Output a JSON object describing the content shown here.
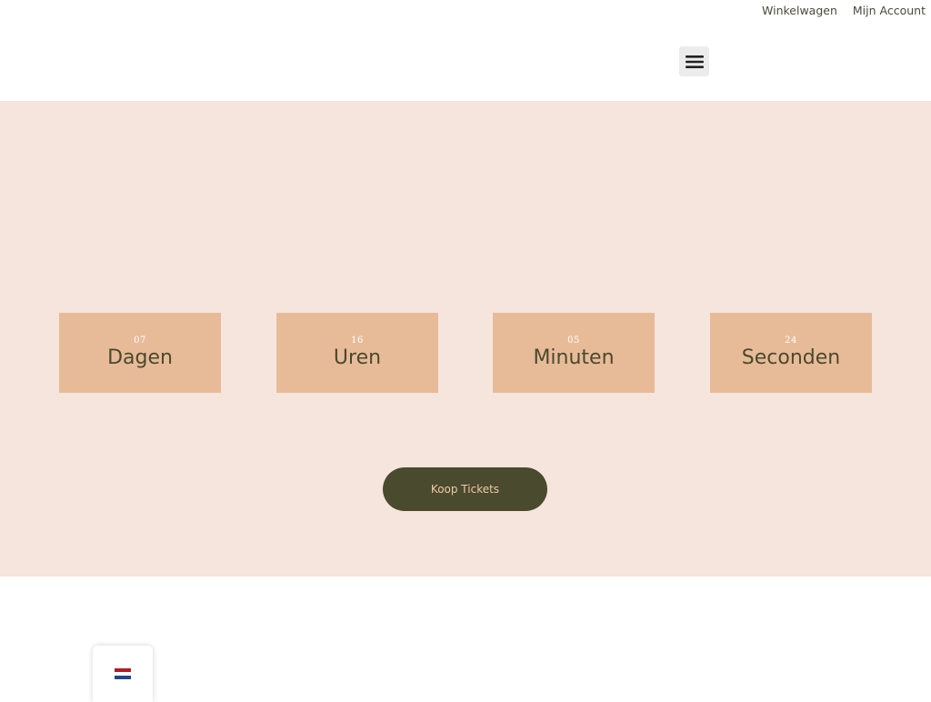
{
  "header": {
    "top_links": {
      "cart": "Winkelwagen",
      "account": "Mijn Account"
    },
    "menu_icon": "hamburger-menu-icon"
  },
  "countdown": {
    "days": {
      "value": "07",
      "label": "Dagen"
    },
    "hours": {
      "value": "16",
      "label": "Uren"
    },
    "minutes": {
      "value": "05",
      "label": "Minuten"
    },
    "seconds": {
      "value": "24",
      "label": "Seconden"
    }
  },
  "cta": {
    "label": "Koop Tickets"
  },
  "language_switcher": {
    "flag": "netherlands-flag-icon",
    "colors": [
      "#ae1c28",
      "#ffffff",
      "#21468b"
    ]
  },
  "colors": {
    "hero_background": "#f6e5dc",
    "countdown_box": "#e8bb98",
    "button_background": "#4a4a2e",
    "button_text": "#f0c9a8"
  }
}
